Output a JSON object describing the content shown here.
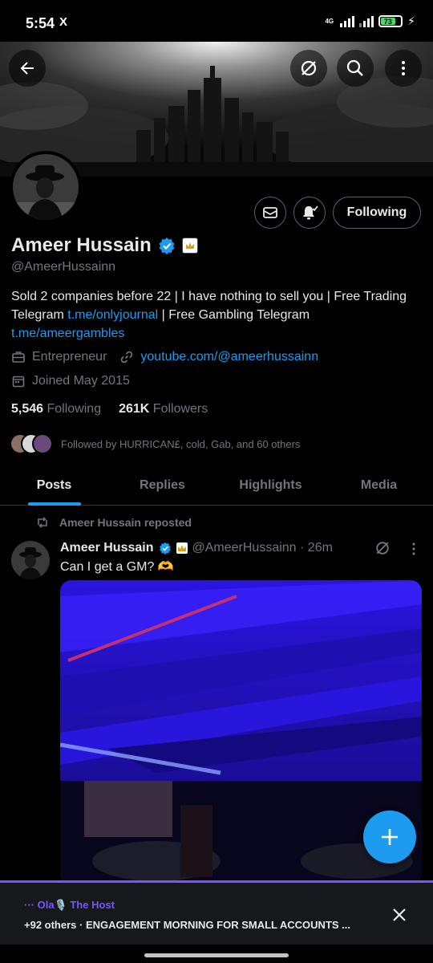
{
  "status_bar": {
    "time": "5:54",
    "app_icon": "X",
    "network": "4G",
    "battery": "73"
  },
  "header": {
    "icons": [
      "back-arrow-icon",
      "grok-icon",
      "search-icon",
      "more-vertical-icon"
    ]
  },
  "profile": {
    "name": "Ameer Hussain",
    "handle": "@AmeerHussainn",
    "bio_parts": {
      "p1": "Sold 2 companies before 22 | I have nothing to sell you | Free Trading Telegram ",
      "link1": "t.me/onlyjournal",
      "p2": " | Free Gambling Telegram ",
      "link2": "t.me/ameergambles"
    },
    "profession": "Entrepreneur",
    "website": "youtube.com/@ameerhussainn",
    "joined": "Joined May 2015",
    "following_count": "5,546",
    "following_label": "Following",
    "followers_count": "261K",
    "followers_label": "Followers",
    "followed_by": "Followed by HURRICAN£, cold, Gab, and 60 others",
    "following_button": "Following"
  },
  "tabs": [
    {
      "label": "Posts",
      "active": true
    },
    {
      "label": "Replies",
      "active": false
    },
    {
      "label": "Highlights",
      "active": false
    },
    {
      "label": "Media",
      "active": false
    }
  ],
  "post": {
    "repost_label": "Ameer Hussain reposted",
    "author_name": "Ameer Hussain",
    "author_meta": "@AmeerHussainn · 26m",
    "text": "Can I get a GM? 🫶"
  },
  "spaces": {
    "host": "··· Ola🎙️ The Host",
    "title": "+92 others · ENGAGEMENT MORNING FOR SMALL ACCOUNTS ..."
  },
  "colors": {
    "accent": "#1d9bf0",
    "spaces": "#7856ff",
    "background": "#000000",
    "muted": "#71767b"
  }
}
